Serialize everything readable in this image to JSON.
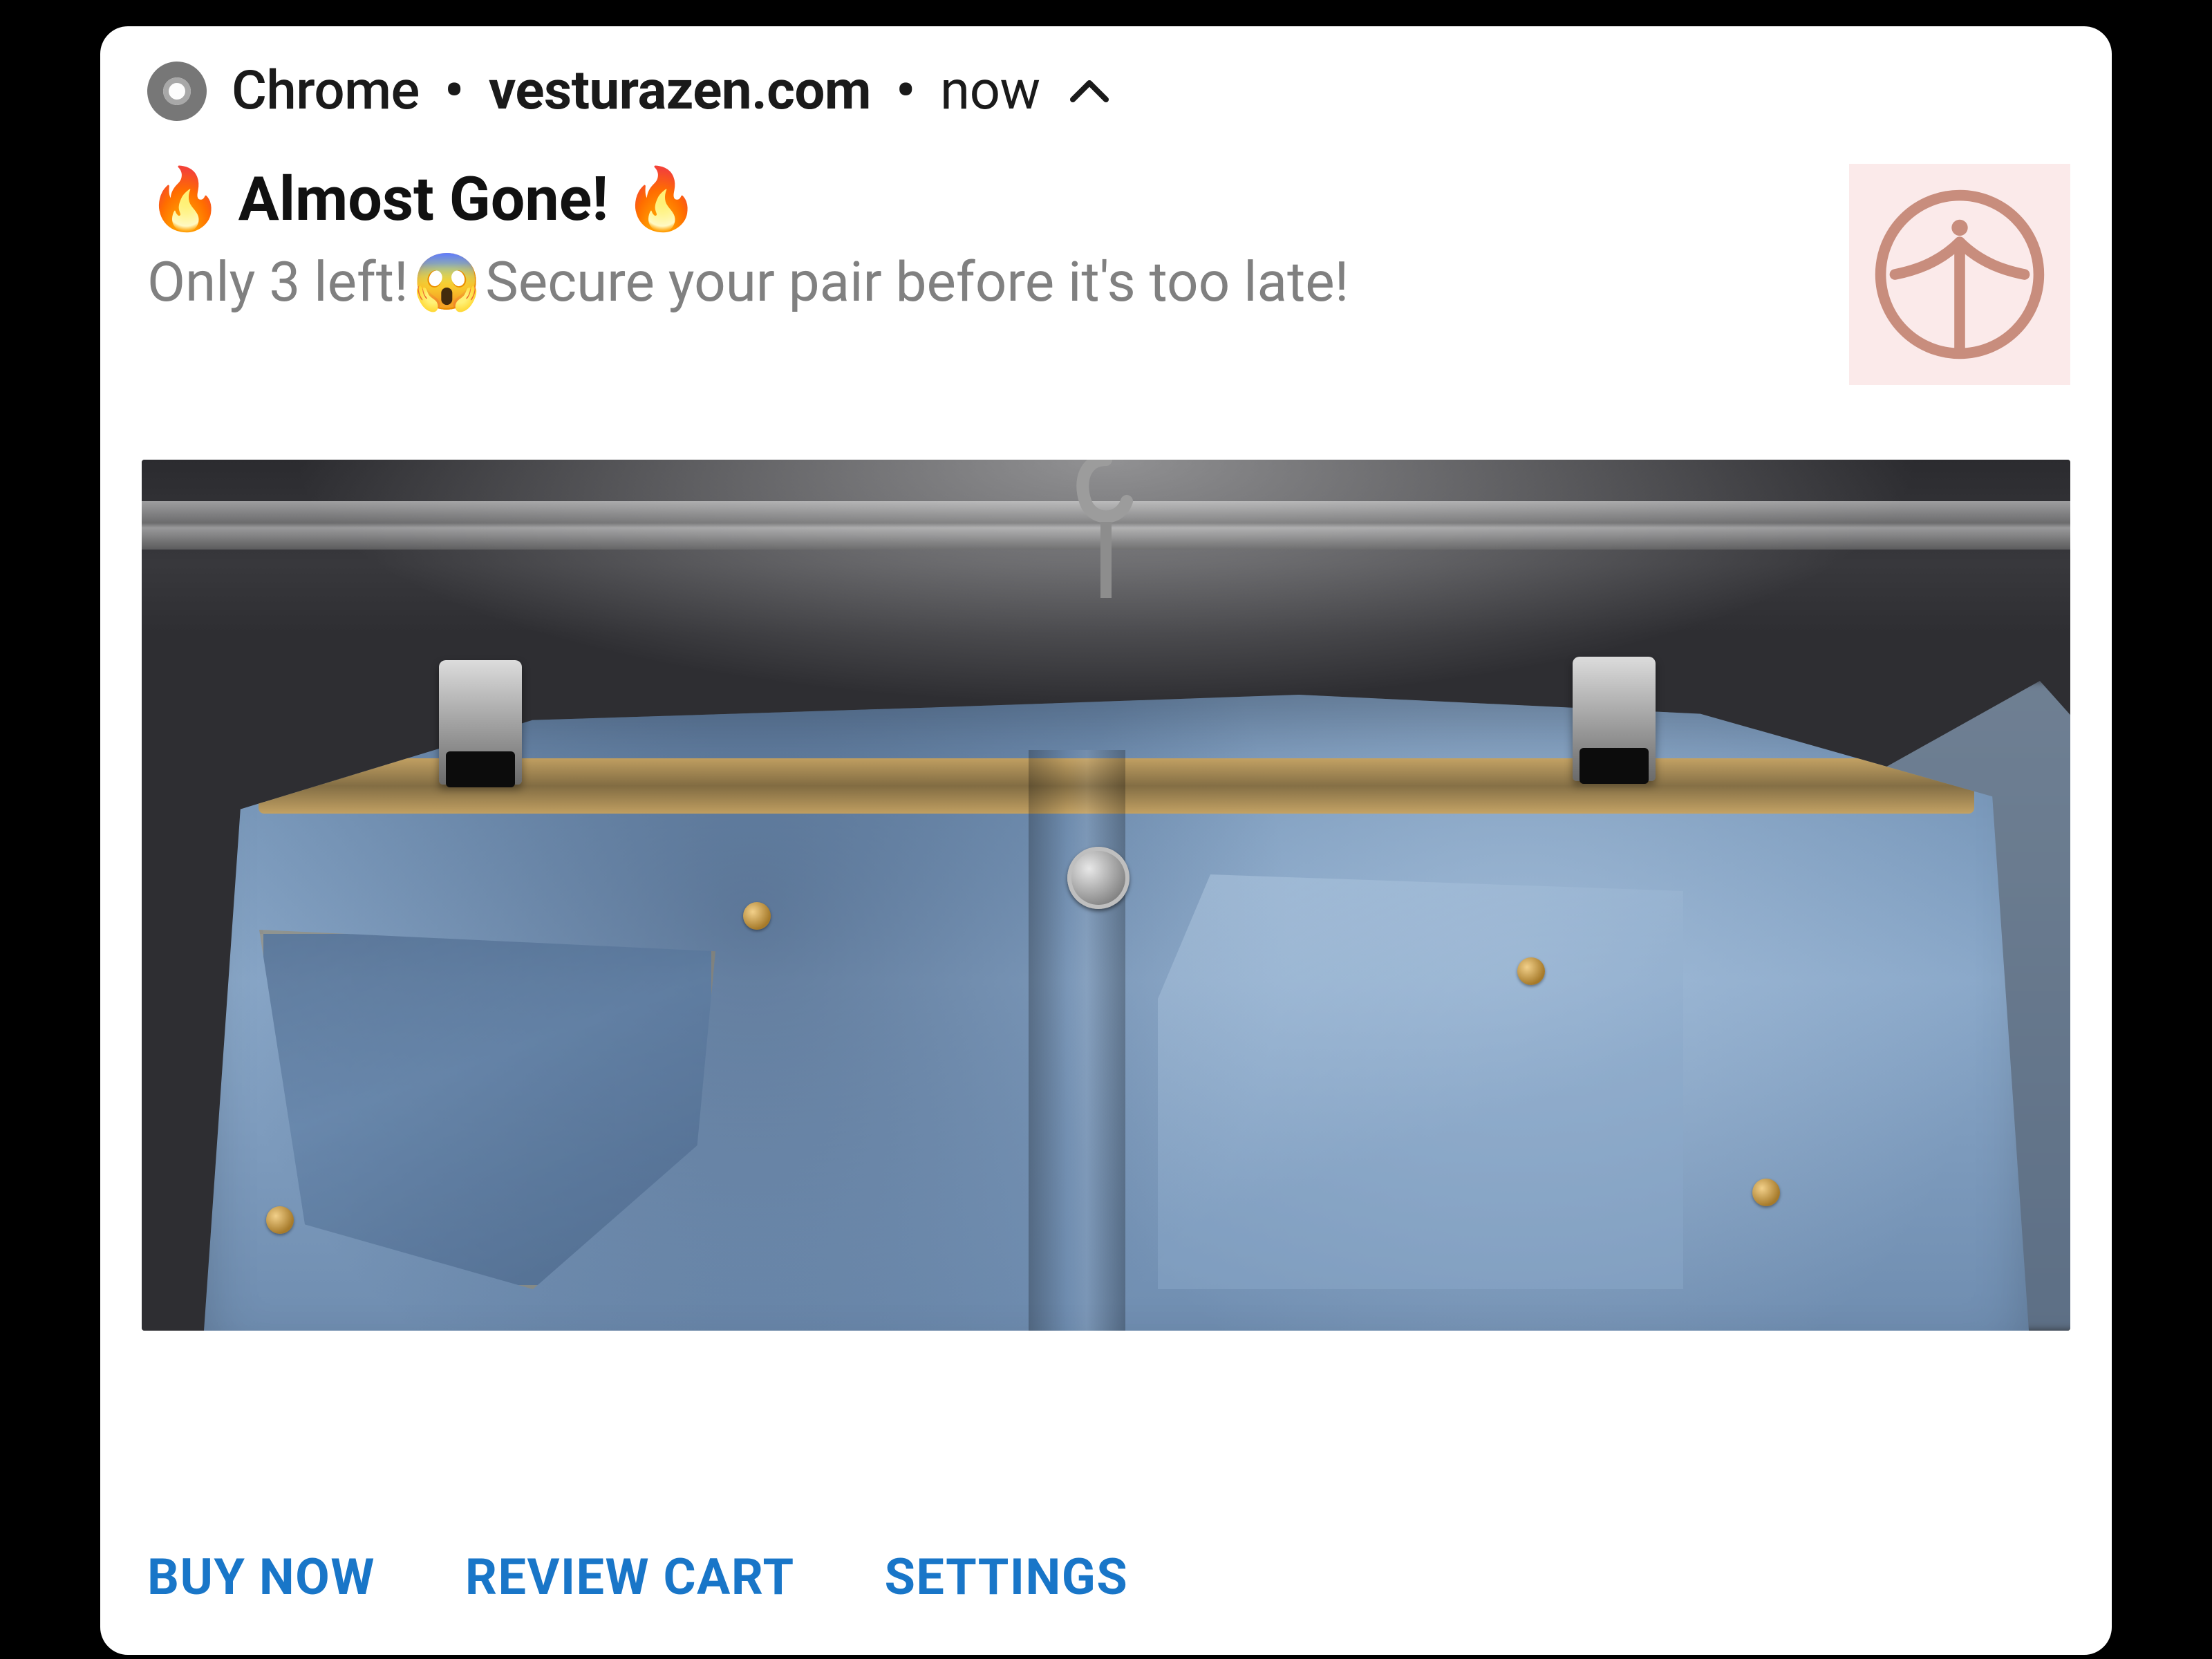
{
  "header": {
    "app_name": "Chrome",
    "separator": "•",
    "origin": "vesturazen.com",
    "time_label": "now",
    "chevron_direction": "up"
  },
  "notification": {
    "title_prefix_emoji": "🔥",
    "title_text": "Almost Gone!",
    "title_suffix_emoji": "🔥",
    "body_prefix": "Only 3 left!",
    "body_emoji": "😱",
    "body_suffix": "Secure your pair before it's too late!"
  },
  "site_icon": {
    "semantic": "vesturazen-logo",
    "bg_color": "#fbeaea",
    "stroke_color": "#c88d7d"
  },
  "hero_image": {
    "semantic": "jeans-on-hangers-photo"
  },
  "actions": [
    {
      "id": "buy-now",
      "label": "BUY NOW"
    },
    {
      "id": "review-cart",
      "label": "REVIEW CART"
    },
    {
      "id": "settings",
      "label": "SETTINGS"
    }
  ],
  "colors": {
    "action_link": "#1976c8",
    "body_text_muted": "#808080",
    "title_text": "#111111"
  }
}
